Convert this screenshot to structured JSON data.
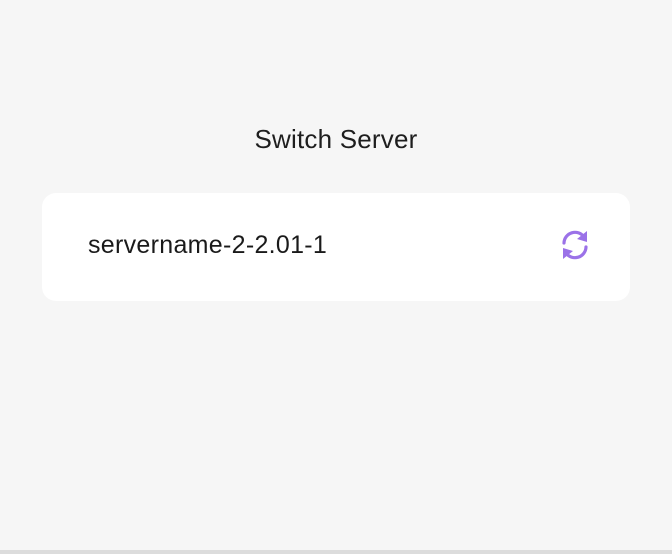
{
  "page": {
    "title": "Switch Server"
  },
  "server": {
    "name": "servername-2-2.01-1",
    "refresh_icon": "refresh-icon"
  },
  "colors": {
    "background": "#f6f6f6",
    "card": "#ffffff",
    "accent": "#9b72e8",
    "text": "#1a1a1a"
  }
}
